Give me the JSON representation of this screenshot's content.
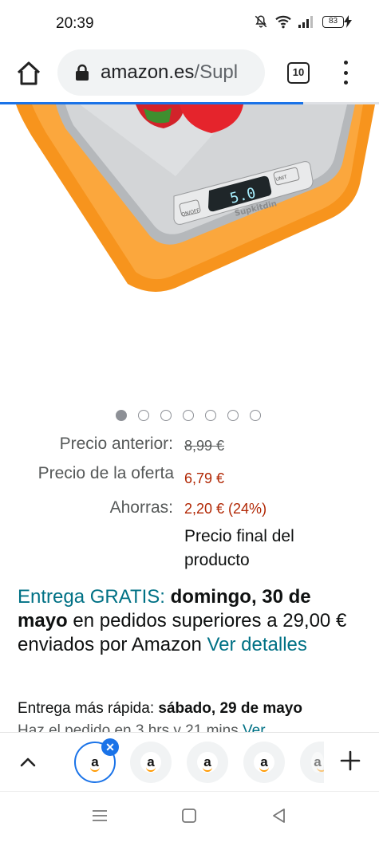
{
  "status_bar": {
    "time": "20:39",
    "battery": "83"
  },
  "browser": {
    "url_host": "amazon.es",
    "url_path": "/Supl",
    "tab_count": "10",
    "progress_fraction": 0.8
  },
  "gallery": {
    "dot_count": 7,
    "active_index": 0,
    "scale_display": "5.0",
    "scale_brand": "Supkitdin",
    "scale_btn_left": "ON/OFF",
    "scale_btn_right": "UNIT"
  },
  "price": {
    "previous_label": "Precio anterior:",
    "previous_value": "8,99 €",
    "deal_label": "Precio de la oferta",
    "deal_value": "6,79 €",
    "savings_label": "Ahorras:",
    "savings_value": "2,20 € (24%)",
    "final_note": "Precio final del producto"
  },
  "delivery": {
    "free_label": "Entrega GRATIS:",
    "date": "domingo, 30 de mayo",
    "condition": "en pedidos superiores a 29,00 € enviados por Amazon",
    "details_link": "Ver detalles",
    "fast_label": "Entrega más rápida:",
    "fast_date": "sábado, 29 de mayo",
    "order_within": "Haz el pedido en 3 hrs y 21 mins",
    "order_within_link": "Ver"
  },
  "tab_strip": {
    "tab_letter": "a"
  },
  "colors": {
    "accent_blue": "#1a73e8",
    "price_red": "#b12704",
    "link_teal": "#007185",
    "orange": "#f7941d"
  }
}
